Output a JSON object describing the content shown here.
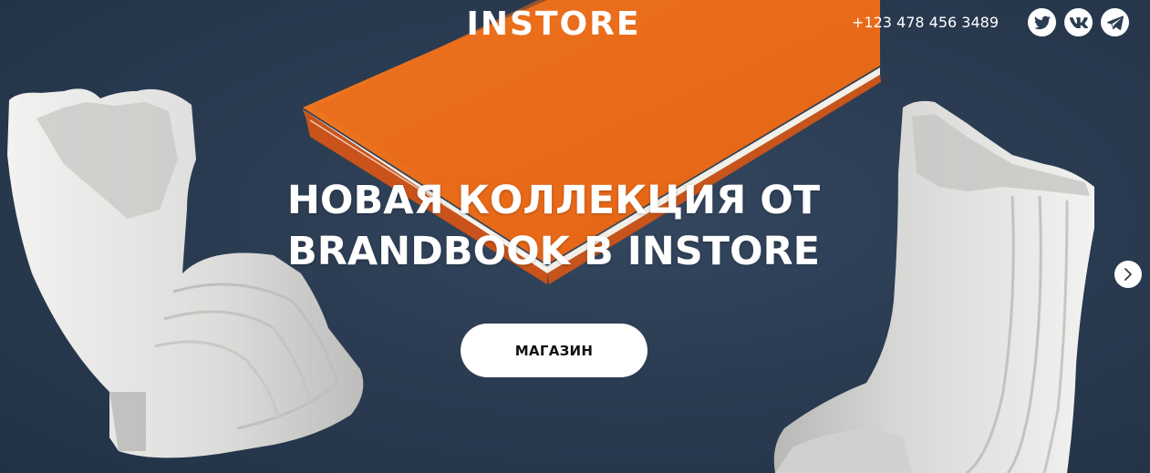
{
  "header": {
    "logo": "INSTORE",
    "phone": "+123 478 456 3489",
    "social_icons": [
      "twitter-icon",
      "vk-icon",
      "telegram-icon"
    ]
  },
  "hero": {
    "headline_line1": "НОВАЯ КОЛЛЕКЦИЯ ОТ",
    "headline_line2": "BRANDBOOK В INSTORE",
    "cta_label": "МАГАЗИН",
    "next_icon": "chevron-right-icon"
  },
  "colors": {
    "background": "#2b3c52",
    "notebook": "#e8671a",
    "ceramic": "#e4e4e2",
    "text": "#ffffff",
    "button_bg": "#ffffff",
    "button_text": "#111111"
  }
}
